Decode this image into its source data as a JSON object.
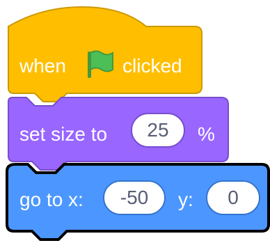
{
  "colors": {
    "events": "#FFBF00",
    "events_border": "#CC9900",
    "looks": "#9966FF",
    "looks_border": "#774DCB",
    "motion": "#4C97FF",
    "motion_border": "#000000",
    "flag_green": "#4CBF56",
    "flag_dark": "#45993D"
  },
  "blocks": {
    "when_flag": {
      "when_label": "when",
      "icon": "green-flag-icon",
      "clicked_label": "clicked"
    },
    "set_size": {
      "label": "set size to",
      "value": "25",
      "unit": "%"
    },
    "go_to": {
      "label": "go to x:",
      "x_value": "-50",
      "y_label": "y:",
      "y_value": "0"
    }
  }
}
